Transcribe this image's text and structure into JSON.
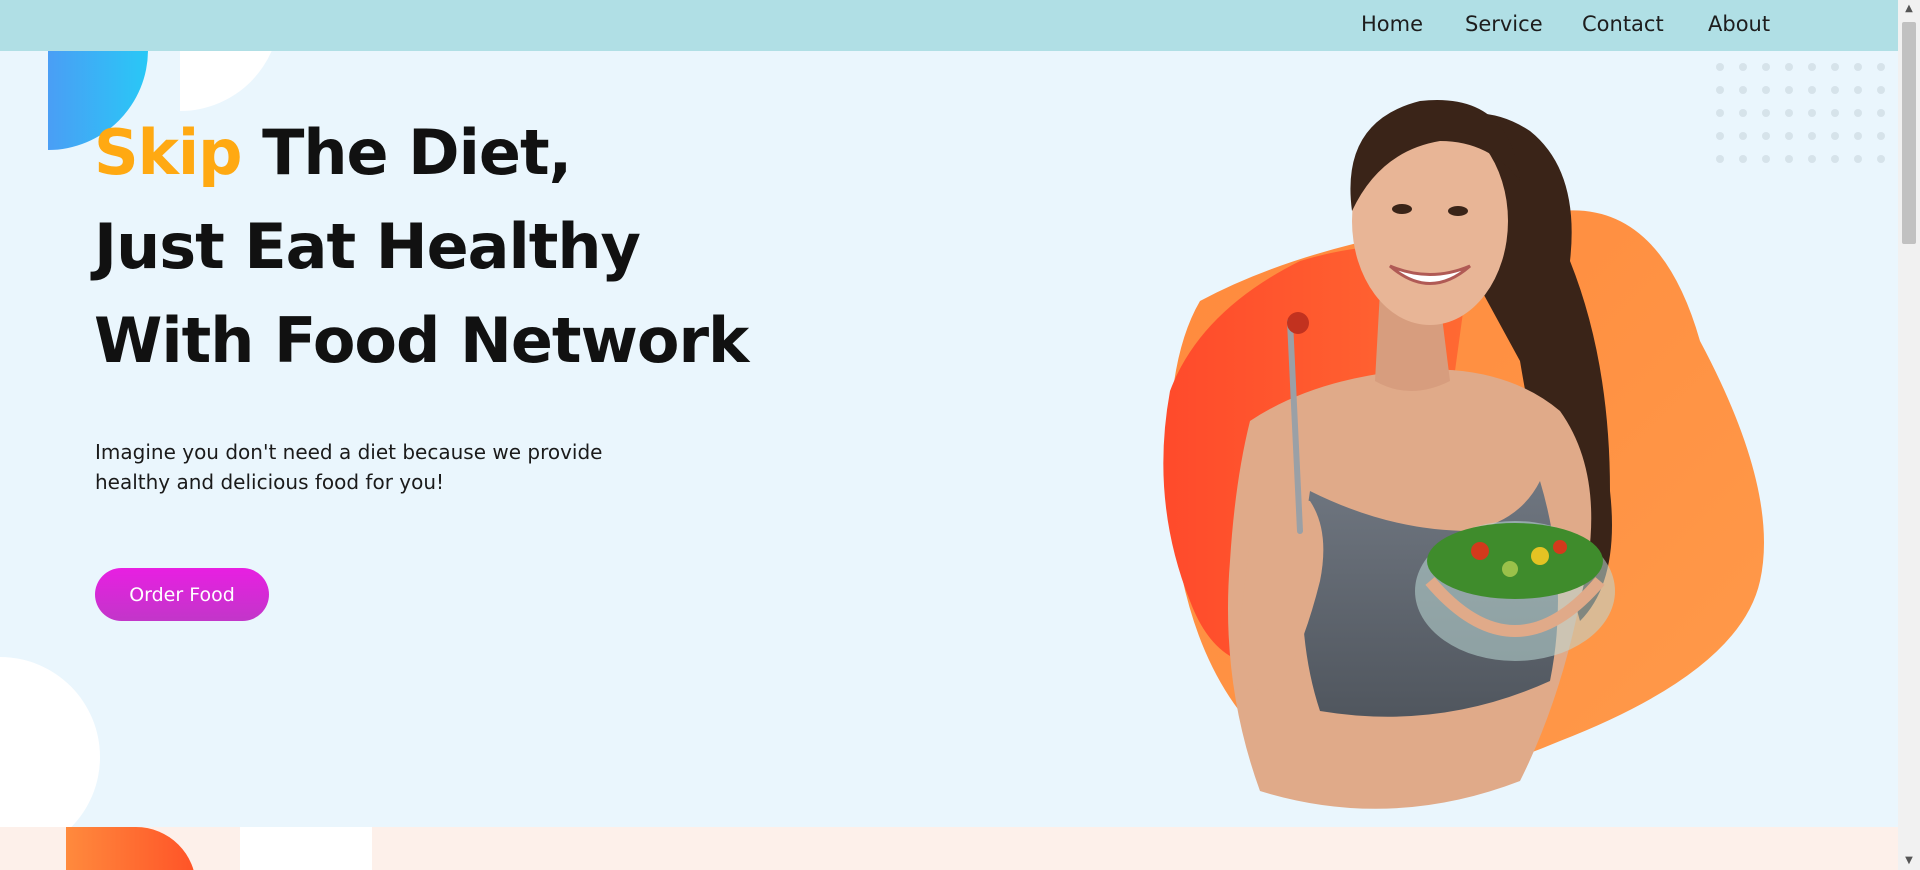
{
  "nav": {
    "items": [
      "Home",
      "Service",
      "Contact",
      "About"
    ]
  },
  "hero": {
    "headline": {
      "line1_accent": "Skip",
      "line1_rest": " The Diet,",
      "line2": "Just Eat Healthy",
      "line3": "With Food Network"
    },
    "subtitle": "Imagine you don't need a diet because we provide healthy and delicious food for you!",
    "cta_label": "Order Food"
  },
  "icons": {
    "scroll_up": "scroll-up-arrow-icon",
    "scroll_down": "scroll-down-arrow-icon"
  },
  "colors": {
    "nav_bg": "#b0dfe5",
    "hero_bg": "#eaf6fd",
    "accent": "#ffa912",
    "button": "#e81fe2",
    "blob_orange": "#ff8a3d",
    "blob_red": "#ff5327",
    "blob_blue": "#29c8f6",
    "lower_section_bg": "#fdf0ea"
  }
}
